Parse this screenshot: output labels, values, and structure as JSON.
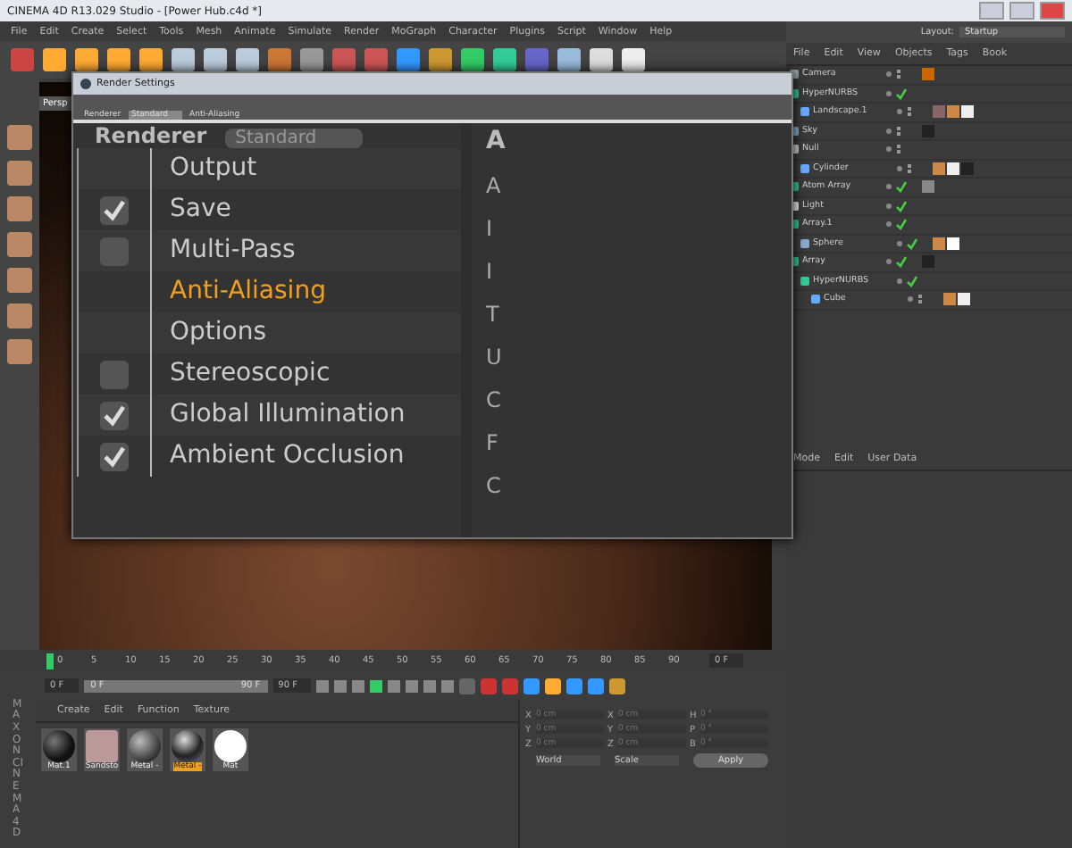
{
  "window": {
    "title": "CINEMA 4D R13.029 Studio - [Power Hub.c4d *]"
  },
  "menu": [
    "File",
    "Edit",
    "Create",
    "Select",
    "Tools",
    "Mesh",
    "Animate",
    "Simulate",
    "Render",
    "MoGraph",
    "Character",
    "Plugins",
    "Script",
    "Window",
    "Help"
  ],
  "layout": {
    "label": "Layout:",
    "value": "Startup"
  },
  "viewport": {
    "tab": "Persp"
  },
  "render_settings": {
    "title": "Render Settings",
    "renderer_label": "Renderer",
    "renderer_value": "Standard",
    "section_title": "Anti-Aliasing",
    "header": "Renderer",
    "header_value": "Standard",
    "right_heading": "A",
    "items": [
      {
        "label": "Output",
        "kind": "plain",
        "selected": false
      },
      {
        "label": "Save",
        "kind": "check",
        "checked": true,
        "selected": false
      },
      {
        "label": "Multi-Pass",
        "kind": "check",
        "checked": false,
        "selected": false
      },
      {
        "label": "Anti-Aliasing",
        "kind": "plain",
        "selected": true
      },
      {
        "label": "Options",
        "kind": "plain",
        "selected": false
      },
      {
        "label": "Stereoscopic",
        "kind": "check",
        "checked": false,
        "selected": false
      },
      {
        "label": "Global Illumination",
        "kind": "check",
        "checked": true,
        "selected": false
      },
      {
        "label": "Ambient Occlusion",
        "kind": "check",
        "checked": true,
        "selected": false
      }
    ],
    "right_letters": [
      "A",
      "I",
      "I",
      "T",
      "U",
      "C",
      "F",
      "C"
    ]
  },
  "object_manager": {
    "menu": [
      "File",
      "Edit",
      "View",
      "Objects",
      "Tags",
      "Book"
    ],
    "objects": [
      {
        "name": "Camera",
        "kind": "camera",
        "enabled": false,
        "tags": [
          {
            "kind": "target"
          }
        ]
      },
      {
        "name": "HyperNURBS",
        "kind": "nurbs",
        "enabled": true,
        "children": [
          {
            "name": "Landscape.1",
            "kind": "cone",
            "enabled": false,
            "tags": [
              {
                "kind": "texture"
              },
              {
                "kind": "phong"
              },
              {
                "kind": "checker"
              }
            ]
          }
        ]
      },
      {
        "name": "Sky",
        "kind": "sphere",
        "enabled": false,
        "tags": [
          {
            "kind": "dark"
          }
        ]
      },
      {
        "name": "Null",
        "kind": "null",
        "enabled": false,
        "children": [
          {
            "name": "Cylinder",
            "kind": "cone",
            "enabled": false,
            "tags": [
              {
                "kind": "phong"
              },
              {
                "kind": "checker"
              },
              {
                "kind": "dark"
              }
            ]
          }
        ]
      },
      {
        "name": "Atom Array",
        "kind": "nurbs",
        "enabled": true,
        "tags": [
          {
            "kind": "grey"
          }
        ]
      },
      {
        "name": "Light",
        "kind": "light",
        "enabled": true
      },
      {
        "name": "Array.1",
        "kind": "nurbs",
        "enabled": true,
        "children": [
          {
            "name": "Sphere",
            "kind": "sphere",
            "enabled": true,
            "tags": [
              {
                "kind": "phong"
              },
              {
                "kind": "white"
              }
            ]
          }
        ]
      },
      {
        "name": "Array",
        "kind": "nurbs",
        "enabled": true,
        "tags": [
          {
            "kind": "dark"
          }
        ],
        "children": [
          {
            "name": "HyperNURBS",
            "kind": "nurbs",
            "enabled": true,
            "children": [
              {
                "name": "Cube",
                "kind": "cone",
                "enabled": false,
                "tags": [
                  {
                    "kind": "phong"
                  },
                  {
                    "kind": "checker"
                  }
                ]
              }
            ]
          }
        ]
      }
    ]
  },
  "attributes": {
    "menu": [
      "Mode",
      "Edit",
      "User Data"
    ]
  },
  "timeline": {
    "ticks": [
      "0",
      "5",
      "10",
      "15",
      "20",
      "25",
      "30",
      "35",
      "40",
      "45",
      "50",
      "55",
      "60",
      "65",
      "70",
      "75",
      "80",
      "85",
      "90"
    ],
    "end_field": "0 F",
    "start": "0 F",
    "range_start": "0 F",
    "range_end": "90 F",
    "end": "90 F"
  },
  "materials": {
    "menu": [
      "Create",
      "Edit",
      "Function",
      "Texture"
    ],
    "items": [
      {
        "name": "Mat.1",
        "kind": "dark",
        "selected": false
      },
      {
        "name": "Sandsto",
        "kind": "cube",
        "selected": false
      },
      {
        "name": "Metal -",
        "kind": "grey",
        "selected": false
      },
      {
        "name": "Metal -",
        "kind": "chrome",
        "selected": true
      },
      {
        "name": "Mat",
        "kind": "white",
        "selected": false
      }
    ]
  },
  "brand": {
    "line1": "MAXON",
    "line2": "CINEMA4D"
  },
  "coordinates": {
    "rows": [
      {
        "a": "X",
        "av": "0 cm",
        "b": "X",
        "bv": "0 cm",
        "c": "H",
        "cv": "0 °"
      },
      {
        "a": "Y",
        "av": "0 cm",
        "b": "Y",
        "bv": "0 cm",
        "c": "P",
        "cv": "0 °"
      },
      {
        "a": "Z",
        "av": "0 cm",
        "b": "Z",
        "bv": "0 cm",
        "c": "B",
        "cv": "0 °"
      }
    ],
    "space": "World",
    "mode": "Scale",
    "apply": "Apply"
  }
}
